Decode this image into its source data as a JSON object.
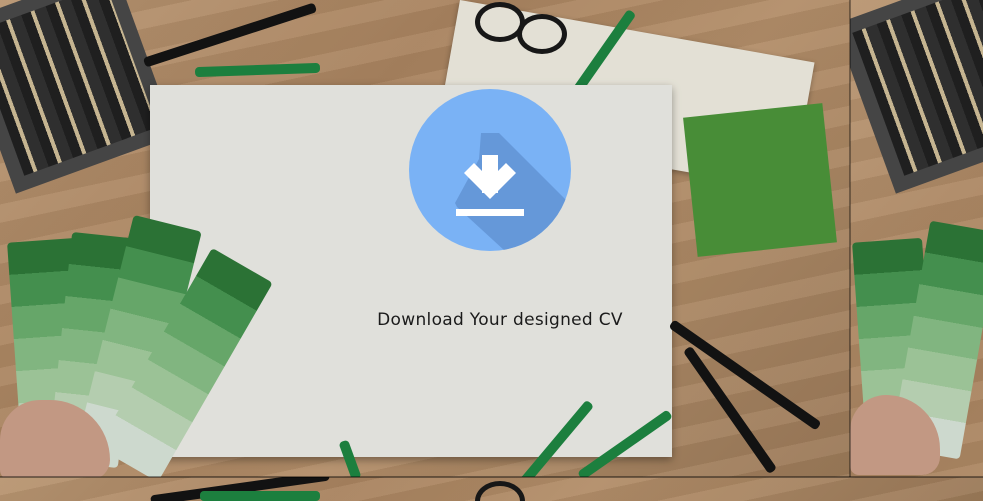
{
  "download": {
    "icon": "download-icon",
    "color": "#7ab2f5",
    "shadow_color": "#5f8fcf",
    "caption": "Download Your designed CV"
  },
  "background": {
    "scene": "desk-with-paper-pens-and-green-swatches",
    "wood_color": "#c39b73",
    "paper_color": "#f4f3ee",
    "accent_green": "#4f9a3c"
  }
}
